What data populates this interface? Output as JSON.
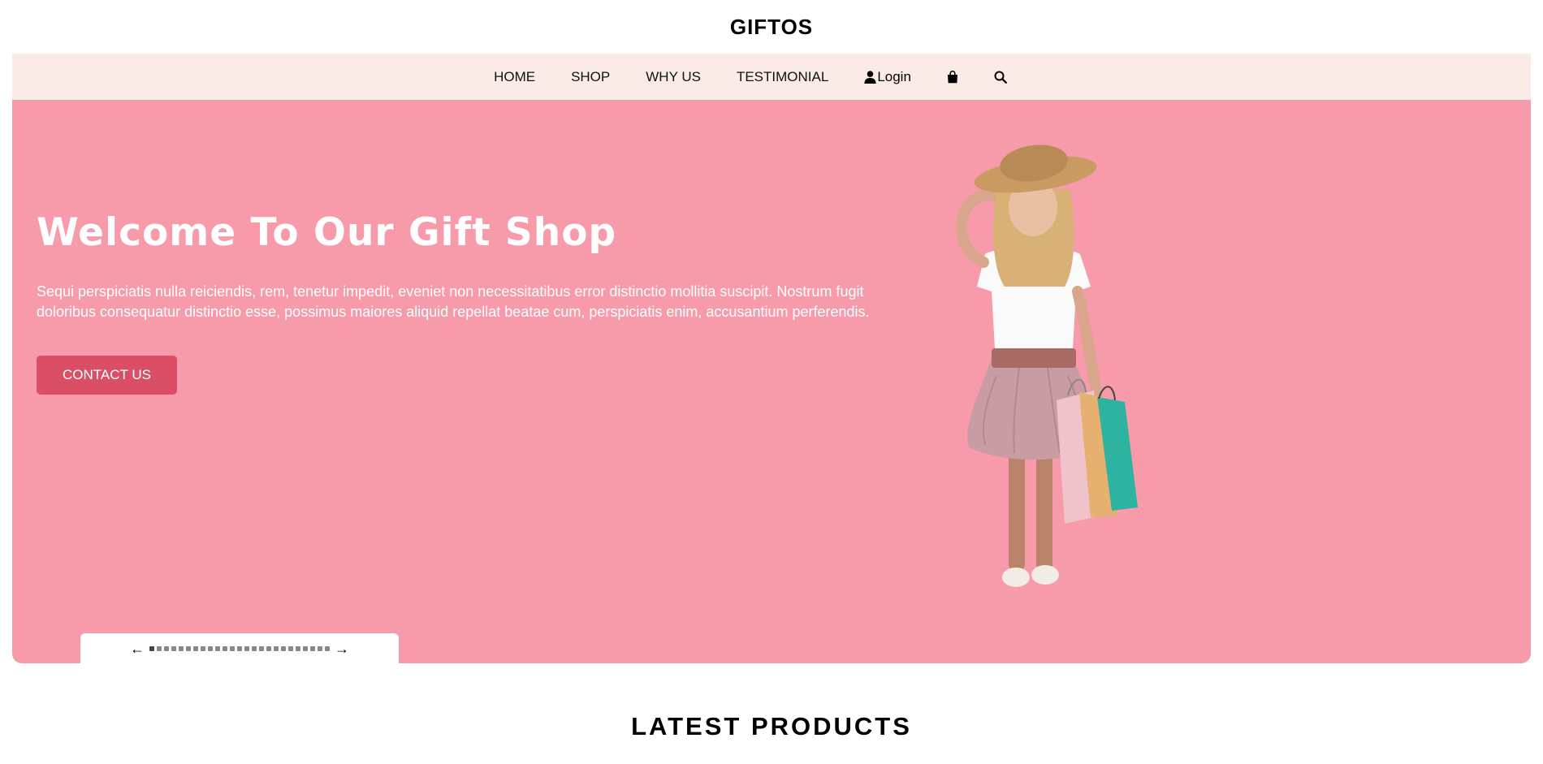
{
  "brand": {
    "name": "GIFTOS"
  },
  "nav": {
    "items": [
      {
        "label": "HOME"
      },
      {
        "label": "SHOP"
      },
      {
        "label": "WHY US"
      },
      {
        "label": "TESTIMONIAL"
      }
    ],
    "login_label": "Login",
    "icons": [
      "user-icon",
      "shopping-bag-icon",
      "search-icon"
    ]
  },
  "hero": {
    "title": "Welcome To Our Gift Shop",
    "description": "Sequi perspiciatis nulla reiciendis, rem, tenetur impedit, eveniet non necessitatibus error distinctio mollitia suscipit. Nostrum fugit doloribus consequatur distinctio esse, possimus maiores aliquid repellat beatae cum, perspiciatis enim, accusantium perferendis.",
    "button_label": "CONTACT US",
    "image": "girl-with-shopping-bags",
    "background_color": "#f79aaa",
    "button_color": "#db4f66"
  },
  "carousel": {
    "prev_icon": "arrow-left-icon",
    "next_icon": "arrow-right-icon",
    "indicator_count": 25,
    "active_index": 0
  },
  "latest": {
    "title": "LATEST PRODUCTS"
  }
}
